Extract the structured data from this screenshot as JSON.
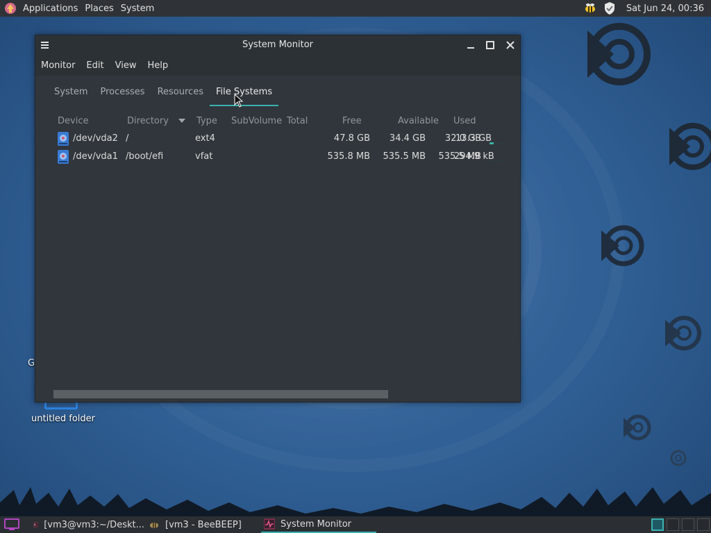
{
  "top_panel": {
    "menus": [
      "Applications",
      "Places",
      "System"
    ],
    "clock": "Sat Jun 24, 00:36"
  },
  "window": {
    "title": "System Monitor",
    "menubar": [
      "Monitor",
      "Edit",
      "View",
      "Help"
    ],
    "tabs": [
      {
        "label": "System",
        "active": false
      },
      {
        "label": "Processes",
        "active": false
      },
      {
        "label": "Resources",
        "active": false
      },
      {
        "label": "File Systems",
        "active": true
      }
    ],
    "columns": [
      "Device",
      "Directory",
      "Type",
      "SubVolume",
      "Total",
      "Free",
      "Available",
      "Used"
    ],
    "rows": [
      {
        "device": "/dev/vda2",
        "directory": "/",
        "type": "ext4",
        "subvolume": "",
        "total": "47.8 GB",
        "free": "34.4 GB",
        "available": "32.0 GB",
        "used": "13.3 GB",
        "used_fraction": 0.28
      },
      {
        "device": "/dev/vda1",
        "directory": "/boot/efi",
        "type": "vfat",
        "subvolume": "",
        "total": "535.8 MB",
        "free": "535.5 MB",
        "available": "535.5 MB",
        "used": "294.9 kB",
        "used_fraction": 0.001
      }
    ]
  },
  "desktop": {
    "icon_label": "untitled folder",
    "partial_label": "G"
  },
  "taskbar": {
    "tasks": [
      {
        "label": "[vm3@vm3:~/Deskt..."
      },
      {
        "label": "[vm3 - BeeBEEP]"
      },
      {
        "label": "System Monitor"
      }
    ]
  },
  "colors": {
    "accent": "#3bb1b1",
    "panel": "#2f3337",
    "window_bg": "#30363b",
    "desktop": "#2f5e93"
  }
}
